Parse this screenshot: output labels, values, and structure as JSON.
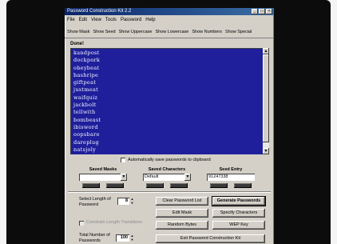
{
  "window": {
    "title": "Password Construction Kit 2.2"
  },
  "menu": [
    "File",
    "Edit",
    "View",
    "Tools",
    "Password",
    "Help"
  ],
  "toolbar": [
    "Show Mask",
    "Show Seed",
    "Show Uppercase",
    "Show Lowercase",
    "Show Numbers",
    "Show Special"
  ],
  "list": {
    "label": "Done!",
    "items": [
      "kandpost",
      "dockpork",
      "obeybeat",
      "hashripe",
      "giftpeat",
      "justmeat",
      "waifquiz",
      "jackbolt",
      "tellwith",
      "bombeast",
      "ibisword",
      "oopsbare",
      "dareplug",
      "natsjoly"
    ]
  },
  "autosave_label": "Automatically save passwords to clipboard",
  "sections": {
    "masks": {
      "title": "Saved Masks",
      "value": ""
    },
    "chars": {
      "title": "Saved Characters",
      "value": "Default"
    },
    "seed": {
      "title": "Seed Entry",
      "value": "91247338"
    }
  },
  "length": {
    "label": "Select Length of Password",
    "value": "8"
  },
  "constrain_label": "Constrain Length Transitions",
  "total": {
    "label": "Total Number of Passwords",
    "value": "100"
  },
  "buttons": {
    "clear": "Clear Password List",
    "generate": "Generate Passwords",
    "edit_mask": "Edit Mask",
    "specify": "Specify Characters",
    "random": "Random Bytes",
    "wep": "WEP Key",
    "exit": "Exit Password Construction Kit"
  },
  "colors": {
    "list_bg": "#1f1f9c",
    "list_text": "#f4f4ff",
    "title_bar": "#0a246a"
  }
}
